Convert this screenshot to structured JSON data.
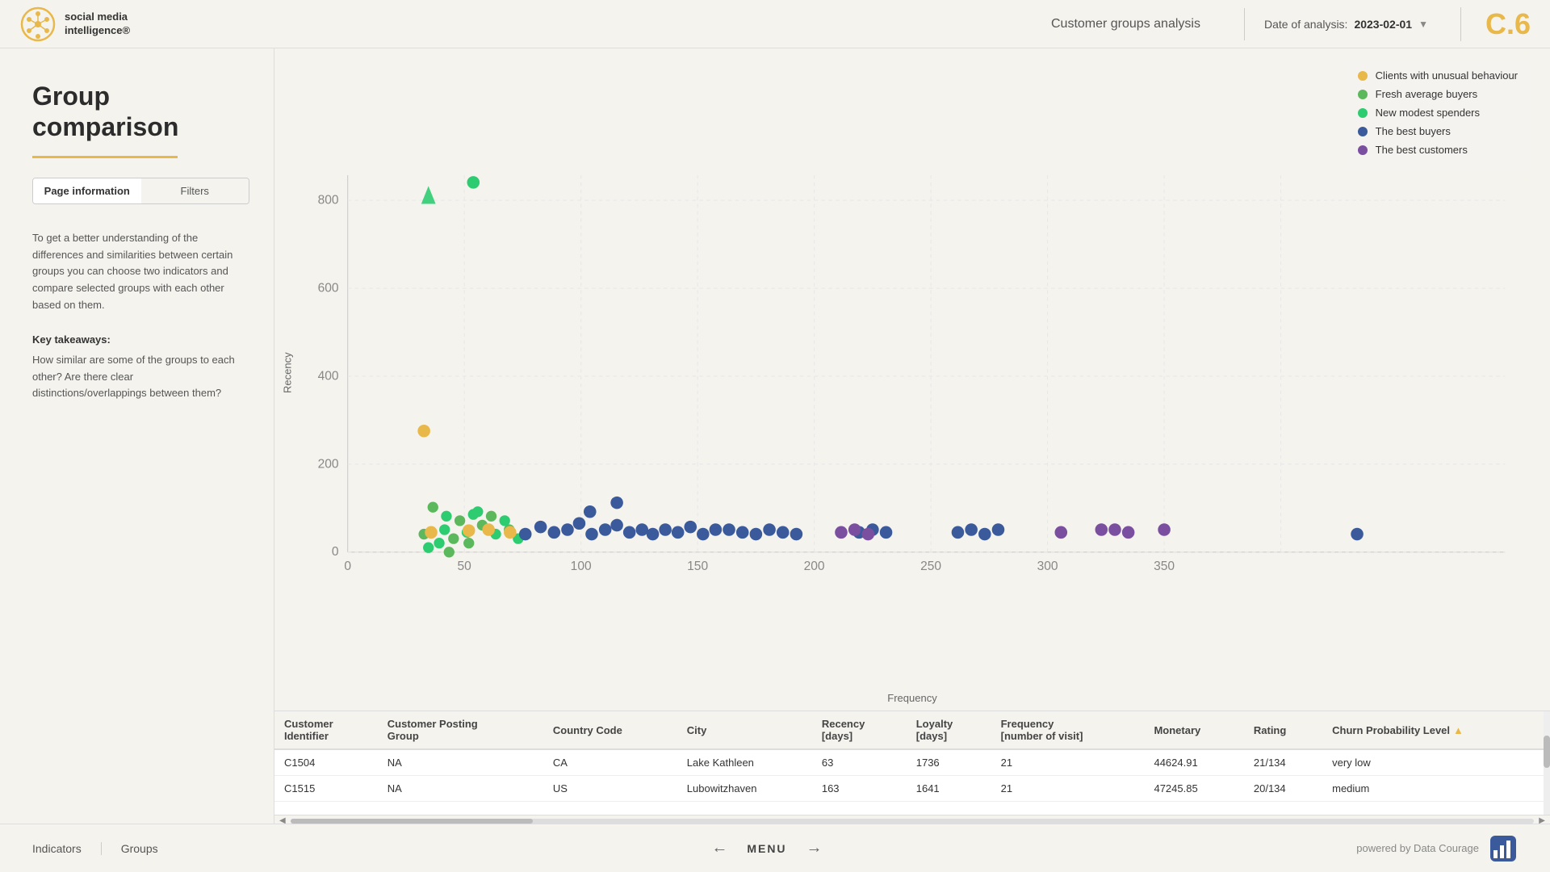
{
  "header": {
    "logo_line1": "social media",
    "logo_line2": "intelligence®",
    "title": "Customer groups analysis",
    "date_label": "Date of analysis:",
    "date_value": "2023-02-01",
    "page_code": "C.6"
  },
  "sidebar": {
    "title": "Group\ncomparison",
    "tab_page_info": "Page information",
    "tab_filters": "Filters",
    "description": "To get a better understanding of the differences and similarities between certain groups you can choose two indicators and compare selected groups with each other based on them.",
    "key_takeaways_label": "Key takeaways:",
    "key_takeaways_body": "How similar are some of the groups to each other? Are there clear distinctions/overlappings between them?"
  },
  "chart": {
    "y_axis_label": "Recency",
    "x_axis_label": "Frequency",
    "y_ticks": [
      "0",
      "200",
      "400",
      "600",
      "800"
    ],
    "x_ticks": [
      "0",
      "50",
      "100",
      "150",
      "200",
      "250",
      "300",
      "350"
    ]
  },
  "legend": {
    "items": [
      {
        "label": "Clients with unusual behaviour",
        "color": "#e8b84b"
      },
      {
        "label": "Fresh average buyers",
        "color": "#5cb85c"
      },
      {
        "label": "New modest spenders",
        "color": "#2ecc71"
      },
      {
        "label": "The best buyers",
        "color": "#3a5a9b"
      },
      {
        "label": "The best customers",
        "color": "#7b4fa0"
      }
    ]
  },
  "table": {
    "columns": [
      "Customer Identifier",
      "Customer Posting Group",
      "Country Code",
      "City",
      "Recency [days]",
      "Loyalty [days]",
      "Frequency [number of visit]",
      "Monetary",
      "Rating",
      "Churn Probability Level"
    ],
    "rows": [
      [
        "C1504",
        "NA",
        "CA",
        "Lake Kathleen",
        "63",
        "1736",
        "21",
        "44624.91",
        "21/134",
        "very low"
      ],
      [
        "C1515",
        "NA",
        "US",
        "Lubowitzhaven",
        "163",
        "1641",
        "21",
        "47245.85",
        "20/134",
        "medium"
      ]
    ]
  },
  "footer": {
    "nav_items": [
      "Indicators",
      "Groups"
    ],
    "menu_label": "MENU",
    "powered_text": "powered by Data Courage"
  }
}
